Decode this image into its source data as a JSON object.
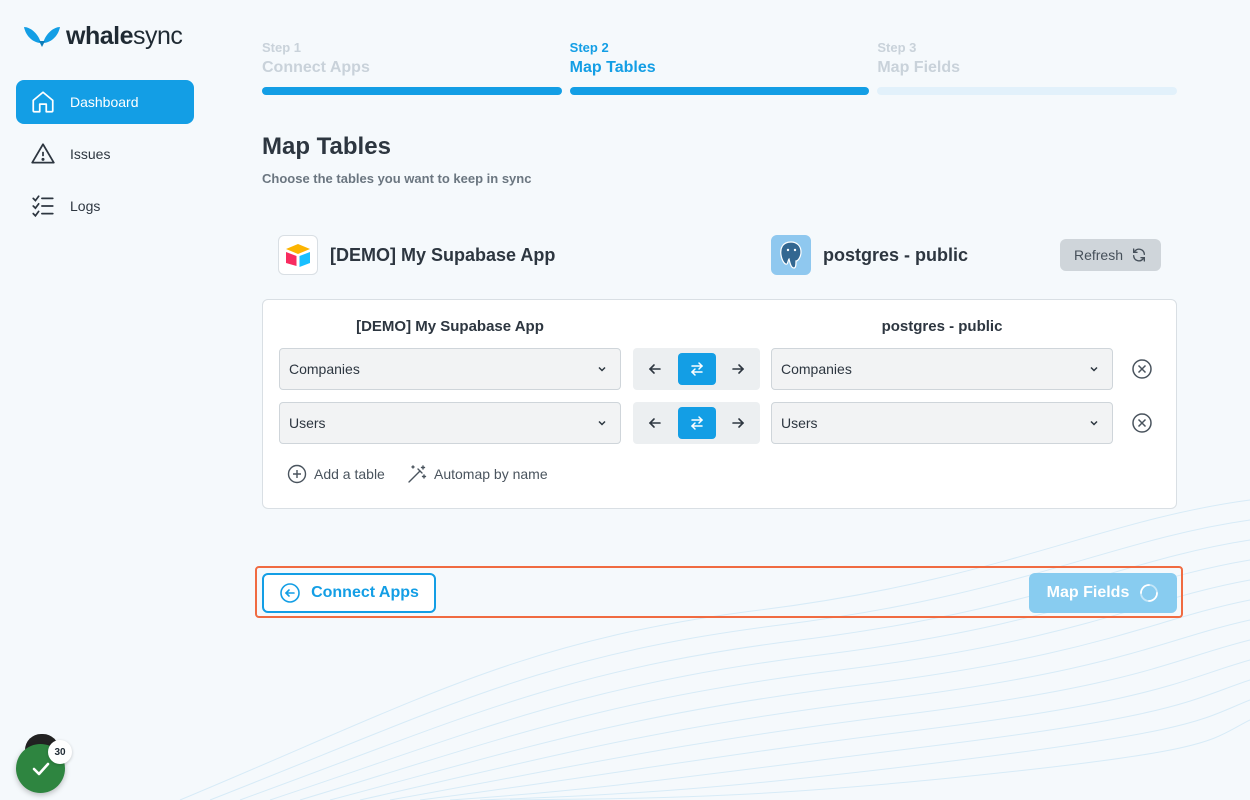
{
  "brand": {
    "logo_bold": "whale",
    "logo_light": "sync",
    "accent_color": "#139ee5"
  },
  "sidebar": {
    "items": [
      {
        "label": "Dashboard",
        "icon": "home-icon",
        "active": true
      },
      {
        "label": "Issues",
        "icon": "warning-icon",
        "active": false
      },
      {
        "label": "Logs",
        "icon": "checklist-icon",
        "active": false
      }
    ],
    "notification_count": "30"
  },
  "stepper": [
    {
      "step": "Step 1",
      "name": "Connect Apps",
      "state": "done"
    },
    {
      "step": "Step 2",
      "name": "Map Tables",
      "state": "current"
    },
    {
      "step": "Step 3",
      "name": "Map Fields",
      "state": "upcoming"
    }
  ],
  "page": {
    "title": "Map Tables",
    "subtitle": "Choose the tables you want to keep in sync"
  },
  "apps": {
    "left": {
      "name": "[DEMO] My Supabase App",
      "icon": "airtable-icon"
    },
    "right": {
      "name": "postgres - public",
      "icon": "postgres-icon"
    },
    "refresh_label": "Refresh"
  },
  "mapping": {
    "left_header": "[DEMO] My Supabase App",
    "right_header": "postgres - public",
    "rows": [
      {
        "left": "Companies",
        "right": "Companies",
        "direction": "both"
      },
      {
        "left": "Users",
        "right": "Users",
        "direction": "both"
      }
    ],
    "add_table_label": "Add a table",
    "automap_label": "Automap by name"
  },
  "footer": {
    "back_label": "Connect Apps",
    "next_label": "Map Fields"
  }
}
